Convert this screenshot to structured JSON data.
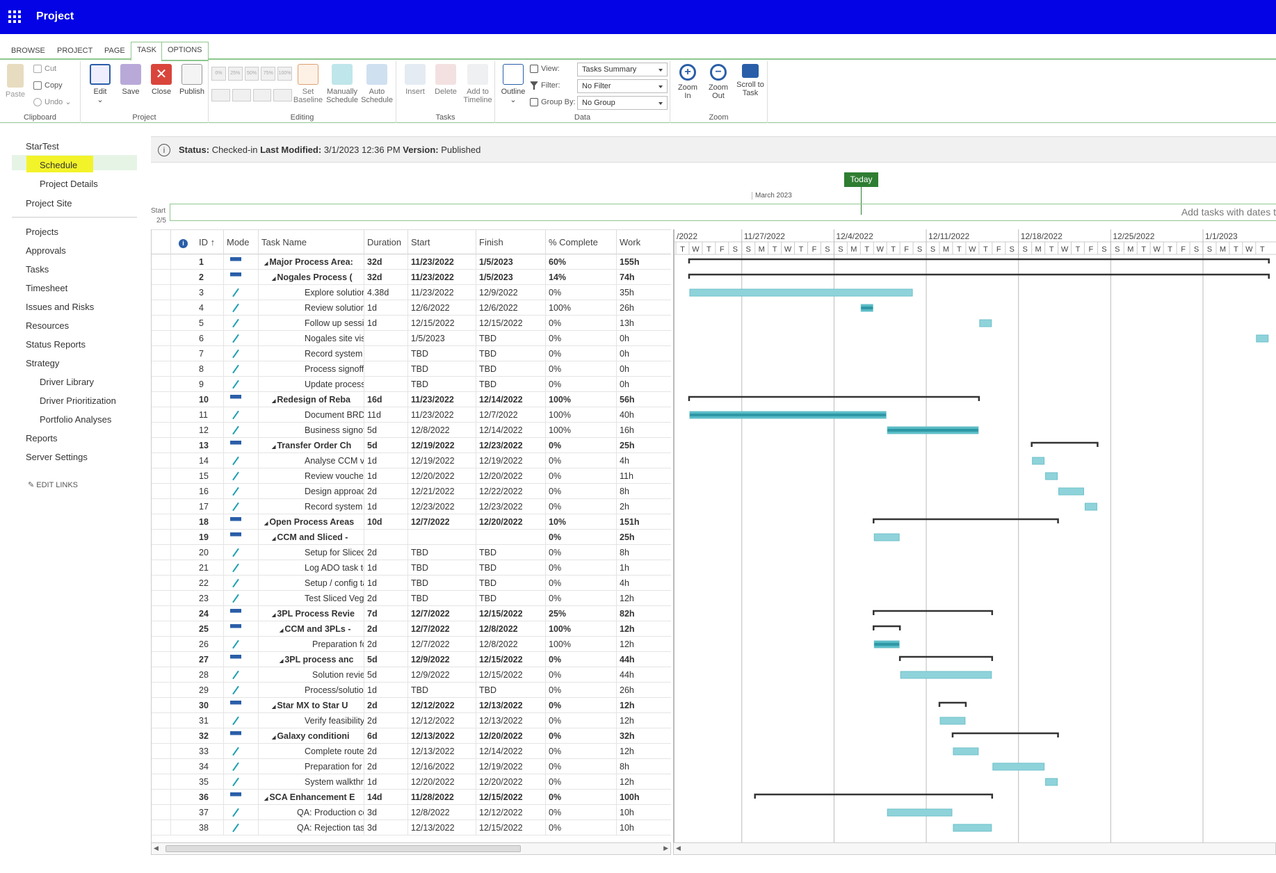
{
  "app": {
    "title": "Project"
  },
  "ribbon": {
    "tabs": [
      "BROWSE",
      "PROJECT",
      "PAGE",
      "TASK",
      "OPTIONS"
    ],
    "active_tab": "TASK",
    "clipboard": {
      "paste": "Paste",
      "cut": "Cut",
      "copy": "Copy",
      "undo": "Undo",
      "label": "Clipboard"
    },
    "project": {
      "edit": "Edit",
      "save": "Save",
      "close": "Close",
      "publish": "Publish",
      "label": "Project"
    },
    "editing": {
      "set_baseline_1": "Set",
      "set_baseline_2": "Baseline",
      "manual_1": "Manually",
      "manual_2": "Schedule",
      "auto_1": "Auto",
      "auto_2": "Schedule",
      "label": "Editing",
      "pct_buttons": [
        "0%",
        "25%",
        "50%",
        "75%",
        "100%"
      ]
    },
    "tasks": {
      "insert": "Insert",
      "delete": "Delete",
      "add_1": "Add to",
      "add_2": "Timeline",
      "label": "Tasks"
    },
    "data": {
      "outline": "Outline",
      "view_label": "View:",
      "view_value": "Tasks Summary",
      "filter_label": "Filter:",
      "filter_value": "No Filter",
      "group_label": "Group By:",
      "group_value": "No Group",
      "label": "Data"
    },
    "zoom": {
      "in_1": "Zoom",
      "in_2": "In",
      "out_1": "Zoom",
      "out_2": "Out",
      "scroll_1": "Scroll to",
      "scroll_2": "Task",
      "label": "Zoom"
    }
  },
  "nav": {
    "items": [
      "StarTest",
      "Schedule",
      "Project Details",
      "Project Site",
      "Projects",
      "Approvals",
      "Tasks",
      "Timesheet",
      "Issues and Risks",
      "Resources",
      "Status Reports",
      "Strategy",
      "Driver Library",
      "Driver Prioritization",
      "Portfolio Analyses",
      "Reports",
      "Server Settings"
    ],
    "edit_links": "EDIT LINKS"
  },
  "status": {
    "status_label": "Status:",
    "status_value": "Checked-in",
    "modified_label": "Last Modified:",
    "modified_value": "3/1/2023 12:36 PM",
    "version_label": "Version:",
    "version_value": "Published"
  },
  "timeline": {
    "today": "Today",
    "month": "March 2023",
    "start_label": "Start",
    "start_date": "2/5",
    "placeholder": "Add tasks with dates t"
  },
  "grid": {
    "headers": [
      "ID",
      "Mode",
      "Task Name",
      "Duration",
      "Start",
      "Finish",
      "% Complete",
      "Work"
    ],
    "rows": [
      {
        "id": "1",
        "name": "Major Process Area:",
        "dur": "32d",
        "start": "11/23/2022",
        "finish": "1/5/2023",
        "pct": "60%",
        "work": "155h",
        "summary": true,
        "lvl": 0
      },
      {
        "id": "2",
        "name": "Nogales Process (",
        "dur": "32d",
        "start": "11/23/2022",
        "finish": "1/5/2023",
        "pct": "14%",
        "work": "74h",
        "summary": true,
        "lvl": 1
      },
      {
        "id": "3",
        "name": "Explore solution",
        "dur": "4.38d",
        "start": "11/23/2022",
        "finish": "12/9/2022",
        "pct": "0%",
        "work": "35h",
        "summary": false,
        "lvl": 2
      },
      {
        "id": "4",
        "name": "Review solution",
        "dur": "1d",
        "start": "12/6/2022",
        "finish": "12/6/2022",
        "pct": "100%",
        "work": "26h",
        "summary": false,
        "lvl": 2
      },
      {
        "id": "5",
        "name": "Follow up sessio",
        "dur": "1d",
        "start": "12/15/2022",
        "finish": "12/15/2022",
        "pct": "0%",
        "work": "13h",
        "summary": false,
        "lvl": 2
      },
      {
        "id": "6",
        "name": "Nogales site visi",
        "dur": "",
        "start": "1/5/2023",
        "finish": "TBD",
        "pct": "0%",
        "work": "0h",
        "summary": false,
        "lvl": 2
      },
      {
        "id": "7",
        "name": "Record system g",
        "dur": "",
        "start": "TBD",
        "finish": "TBD",
        "pct": "0%",
        "work": "0h",
        "summary": false,
        "lvl": 2
      },
      {
        "id": "8",
        "name": "Process signoff",
        "dur": "",
        "start": "TBD",
        "finish": "TBD",
        "pct": "0%",
        "work": "0h",
        "summary": false,
        "lvl": 2
      },
      {
        "id": "9",
        "name": "Update process",
        "dur": "",
        "start": "TBD",
        "finish": "TBD",
        "pct": "0%",
        "work": "0h",
        "summary": false,
        "lvl": 2
      },
      {
        "id": "10",
        "name": "Redesign of Reba",
        "dur": "16d",
        "start": "11/23/2022",
        "finish": "12/14/2022",
        "pct": "100%",
        "work": "56h",
        "summary": true,
        "lvl": 1
      },
      {
        "id": "11",
        "name": "Document BRD",
        "dur": "11d",
        "start": "11/23/2022",
        "finish": "12/7/2022",
        "pct": "100%",
        "work": "40h",
        "summary": false,
        "lvl": 2
      },
      {
        "id": "12",
        "name": "Business signoff",
        "dur": "5d",
        "start": "12/8/2022",
        "finish": "12/14/2022",
        "pct": "100%",
        "work": "16h",
        "summary": false,
        "lvl": 2
      },
      {
        "id": "13",
        "name": "Transfer Order Ch",
        "dur": "5d",
        "start": "12/19/2022",
        "finish": "12/23/2022",
        "pct": "0%",
        "work": "25h",
        "summary": true,
        "lvl": 1
      },
      {
        "id": "14",
        "name": "Analyse CCM vo",
        "dur": "1d",
        "start": "12/19/2022",
        "finish": "12/19/2022",
        "pct": "0%",
        "work": "4h",
        "summary": false,
        "lvl": 2
      },
      {
        "id": "15",
        "name": "Review voucher",
        "dur": "1d",
        "start": "12/20/2022",
        "finish": "12/20/2022",
        "pct": "0%",
        "work": "11h",
        "summary": false,
        "lvl": 2
      },
      {
        "id": "16",
        "name": "Design approach",
        "dur": "2d",
        "start": "12/21/2022",
        "finish": "12/22/2022",
        "pct": "0%",
        "work": "8h",
        "summary": false,
        "lvl": 2
      },
      {
        "id": "17",
        "name": "Record system g",
        "dur": "1d",
        "start": "12/23/2022",
        "finish": "12/23/2022",
        "pct": "0%",
        "work": "2h",
        "summary": false,
        "lvl": 2
      },
      {
        "id": "18",
        "name": "Open Process Areas",
        "dur": "10d",
        "start": "12/7/2022",
        "finish": "12/20/2022",
        "pct": "10%",
        "work": "151h",
        "summary": true,
        "lvl": 0
      },
      {
        "id": "19",
        "name": "CCM and Sliced -",
        "dur": "",
        "start": "",
        "finish": "",
        "pct": "0%",
        "work": "25h",
        "summary": true,
        "lvl": 1
      },
      {
        "id": "20",
        "name": "Setup for Sliced",
        "dur": "2d",
        "start": "TBD",
        "finish": "TBD",
        "pct": "0%",
        "work": "8h",
        "summary": false,
        "lvl": 2
      },
      {
        "id": "21",
        "name": "Log ADO task to",
        "dur": "1d",
        "start": "TBD",
        "finish": "TBD",
        "pct": "0%",
        "work": "1h",
        "summary": false,
        "lvl": 2
      },
      {
        "id": "22",
        "name": "Setup / config ta",
        "dur": "1d",
        "start": "TBD",
        "finish": "TBD",
        "pct": "0%",
        "work": "4h",
        "summary": false,
        "lvl": 2
      },
      {
        "id": "23",
        "name": "Test Sliced Vegg",
        "dur": "2d",
        "start": "TBD",
        "finish": "TBD",
        "pct": "0%",
        "work": "12h",
        "summary": false,
        "lvl": 2
      },
      {
        "id": "24",
        "name": "3PL Process Revie",
        "dur": "7d",
        "start": "12/7/2022",
        "finish": "12/15/2022",
        "pct": "25%",
        "work": "82h",
        "summary": true,
        "lvl": 1
      },
      {
        "id": "25",
        "name": "CCM and 3PLs -",
        "dur": "2d",
        "start": "12/7/2022",
        "finish": "12/8/2022",
        "pct": "100%",
        "work": "12h",
        "summary": true,
        "lvl": 2
      },
      {
        "id": "26",
        "name": "Preparation fc",
        "dur": "2d",
        "start": "12/7/2022",
        "finish": "12/8/2022",
        "pct": "100%",
        "work": "12h",
        "summary": false,
        "lvl": 3
      },
      {
        "id": "27",
        "name": "3PL process anc",
        "dur": "5d",
        "start": "12/9/2022",
        "finish": "12/15/2022",
        "pct": "0%",
        "work": "44h",
        "summary": true,
        "lvl": 2
      },
      {
        "id": "28",
        "name": "Solution revie",
        "dur": "5d",
        "start": "12/9/2022",
        "finish": "12/15/2022",
        "pct": "0%",
        "work": "44h",
        "summary": false,
        "lvl": 3
      },
      {
        "id": "29",
        "name": "Process/solution",
        "dur": "1d",
        "start": "TBD",
        "finish": "TBD",
        "pct": "0%",
        "work": "26h",
        "summary": false,
        "lvl": 2
      },
      {
        "id": "30",
        "name": "Star MX to Star U",
        "dur": "2d",
        "start": "12/12/2022",
        "finish": "12/13/2022",
        "pct": "0%",
        "work": "12h",
        "summary": true,
        "lvl": 1
      },
      {
        "id": "31",
        "name": "Verify feasibility",
        "dur": "2d",
        "start": "12/12/2022",
        "finish": "12/13/2022",
        "pct": "0%",
        "work": "12h",
        "summary": false,
        "lvl": 2
      },
      {
        "id": "32",
        "name": "Galaxy conditioni",
        "dur": "6d",
        "start": "12/13/2022",
        "finish": "12/20/2022",
        "pct": "0%",
        "work": "32h",
        "summary": true,
        "lvl": 1
      },
      {
        "id": "33",
        "name": "Complete route",
        "dur": "2d",
        "start": "12/13/2022",
        "finish": "12/14/2022",
        "pct": "0%",
        "work": "12h",
        "summary": false,
        "lvl": 2
      },
      {
        "id": "34",
        "name": "Preparation for s",
        "dur": "2d",
        "start": "12/16/2022",
        "finish": "12/19/2022",
        "pct": "0%",
        "work": "8h",
        "summary": false,
        "lvl": 2
      },
      {
        "id": "35",
        "name": "System walkthro",
        "dur": "1d",
        "start": "12/20/2022",
        "finish": "12/20/2022",
        "pct": "0%",
        "work": "12h",
        "summary": false,
        "lvl": 2
      },
      {
        "id": "36",
        "name": "SCA Enhancement E",
        "dur": "14d",
        "start": "11/28/2022",
        "finish": "12/15/2022",
        "pct": "0%",
        "work": "100h",
        "summary": true,
        "lvl": 0
      },
      {
        "id": "37",
        "name": "QA: Production co",
        "dur": "3d",
        "start": "12/8/2022",
        "finish": "12/12/2022",
        "pct": "0%",
        "work": "10h",
        "summary": false,
        "lvl": 1
      },
      {
        "id": "38",
        "name": "QA: Rejection task",
        "dur": "3d",
        "start": "12/13/2022",
        "finish": "12/15/2022",
        "pct": "0%",
        "work": "10h",
        "summary": false,
        "lvl": 1
      }
    ]
  },
  "gantt": {
    "weeks": [
      "/2022",
      "11/27/2022",
      "12/4/2022",
      "12/11/2022",
      "12/18/2022",
      "12/25/2022",
      "1/1/2023"
    ],
    "day_letters": [
      "T",
      "W",
      "T",
      "F",
      "S",
      "S",
      "M",
      "T",
      "W",
      "T",
      "F",
      "S",
      "S",
      "M",
      "T",
      "W",
      "T",
      "F",
      "S",
      "S",
      "M",
      "T",
      "W",
      "T",
      "F",
      "S",
      "S",
      "M",
      "T",
      "W",
      "T",
      "F",
      "S",
      "S",
      "M",
      "T",
      "W",
      "T",
      "F",
      "S",
      "S",
      "M",
      "T",
      "W",
      "T"
    ],
    "first_day": "2022-11-22",
    "bars": [
      {
        "row": 1,
        "type": "summary",
        "start": "2022-11-23",
        "end": "2023-01-05"
      },
      {
        "row": 2,
        "type": "summary",
        "start": "2022-11-23",
        "end": "2023-01-05"
      },
      {
        "row": 3,
        "type": "task",
        "start": "2022-11-23",
        "end": "2022-12-09"
      },
      {
        "row": 4,
        "type": "task",
        "start": "2022-12-06",
        "end": "2022-12-06",
        "progress": 1
      },
      {
        "row": 5,
        "type": "task",
        "start": "2022-12-15",
        "end": "2022-12-15"
      },
      {
        "row": 6,
        "type": "task",
        "start": "2023-01-05",
        "end": "2023-01-05"
      },
      {
        "row": 10,
        "type": "summary",
        "start": "2022-11-23",
        "end": "2022-12-14"
      },
      {
        "row": 11,
        "type": "task",
        "start": "2022-11-23",
        "end": "2022-12-07",
        "progress": 1
      },
      {
        "row": 12,
        "type": "task",
        "start": "2022-12-08",
        "end": "2022-12-14",
        "progress": 1
      },
      {
        "row": 13,
        "type": "summary",
        "start": "2022-12-19",
        "end": "2022-12-23"
      },
      {
        "row": 14,
        "type": "task",
        "start": "2022-12-19",
        "end": "2022-12-19"
      },
      {
        "row": 15,
        "type": "task",
        "start": "2022-12-20",
        "end": "2022-12-20"
      },
      {
        "row": 16,
        "type": "task",
        "start": "2022-12-21",
        "end": "2022-12-22"
      },
      {
        "row": 17,
        "type": "task",
        "start": "2022-12-23",
        "end": "2022-12-23"
      },
      {
        "row": 18,
        "type": "summary",
        "start": "2022-12-07",
        "end": "2022-12-20"
      },
      {
        "row": 19,
        "type": "task",
        "start": "2022-12-07",
        "end": "2022-12-08"
      },
      {
        "row": 24,
        "type": "summary",
        "start": "2022-12-07",
        "end": "2022-12-15"
      },
      {
        "row": 25,
        "type": "summary",
        "start": "2022-12-07",
        "end": "2022-12-08"
      },
      {
        "row": 26,
        "type": "task",
        "start": "2022-12-07",
        "end": "2022-12-08",
        "progress": 1
      },
      {
        "row": 27,
        "type": "summary",
        "start": "2022-12-09",
        "end": "2022-12-15"
      },
      {
        "row": 28,
        "type": "task",
        "start": "2022-12-09",
        "end": "2022-12-15"
      },
      {
        "row": 30,
        "type": "summary",
        "start": "2022-12-12",
        "end": "2022-12-13"
      },
      {
        "row": 31,
        "type": "task",
        "start": "2022-12-12",
        "end": "2022-12-13"
      },
      {
        "row": 32,
        "type": "summary",
        "start": "2022-12-13",
        "end": "2022-12-20"
      },
      {
        "row": 33,
        "type": "task",
        "start": "2022-12-13",
        "end": "2022-12-14"
      },
      {
        "row": 34,
        "type": "task",
        "start": "2022-12-16",
        "end": "2022-12-19"
      },
      {
        "row": 35,
        "type": "task",
        "start": "2022-12-20",
        "end": "2022-12-20"
      },
      {
        "row": 36,
        "type": "summary",
        "start": "2022-11-28",
        "end": "2022-12-15"
      },
      {
        "row": 37,
        "type": "task",
        "start": "2022-12-08",
        "end": "2022-12-12"
      },
      {
        "row": 38,
        "type": "task",
        "start": "2022-12-13",
        "end": "2022-12-15"
      }
    ]
  },
  "colors": {
    "suitebar": "#0303e6",
    "bar": "#8fd3da",
    "bar_done": "#4fb5c0",
    "today": "#2e7d32",
    "highlight": "#f3f32a"
  }
}
